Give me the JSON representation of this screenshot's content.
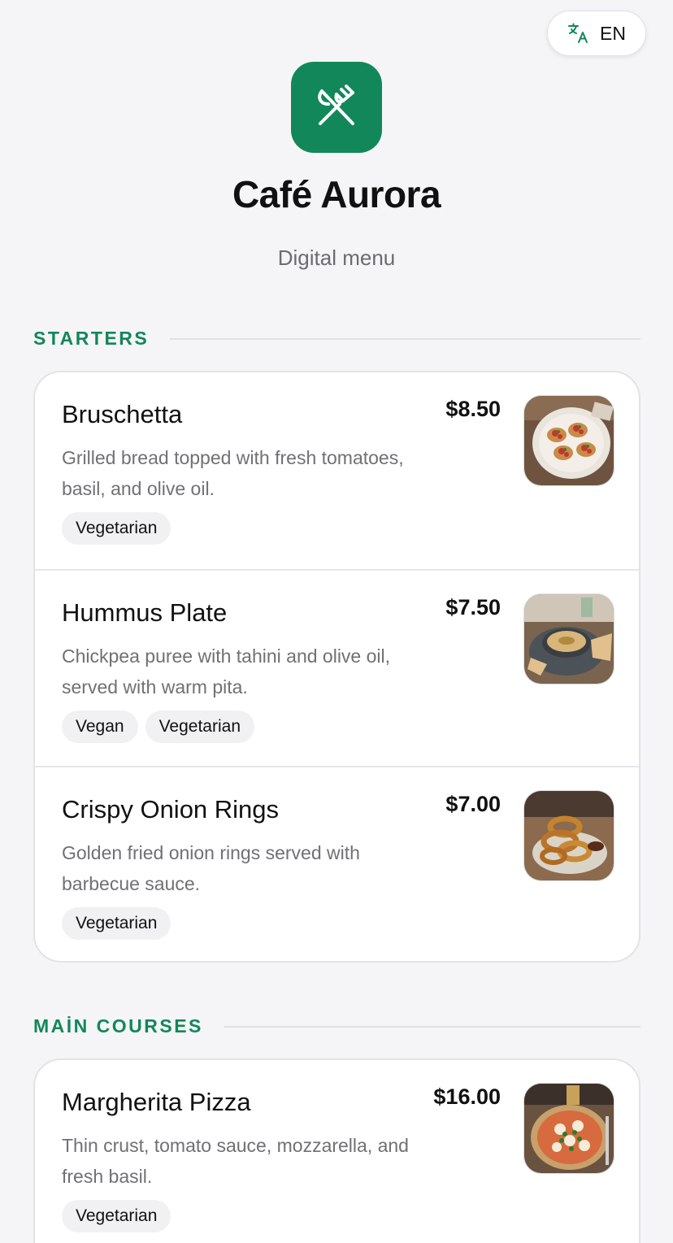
{
  "language": {
    "icon": "translate-icon",
    "code": "EN"
  },
  "brand": {
    "logo_icon": "utensils-crossed-icon",
    "accent": "#12875a",
    "name": "Café Aurora",
    "subtitle": "Digital menu"
  },
  "sections": [
    {
      "title": "STARTERS",
      "items": [
        {
          "name": "Bruschetta",
          "price": "$8.50",
          "description": "Grilled bread topped with fresh tomatoes, basil, and olive oil.",
          "tags": [
            "Vegetarian"
          ],
          "image": "bruschetta-photo"
        },
        {
          "name": "Hummus Plate",
          "price": "$7.50",
          "description": "Chickpea puree with tahini and olive oil, served with warm pita.",
          "tags": [
            "Vegan",
            "Vegetarian"
          ],
          "image": "hummus-photo"
        },
        {
          "name": "Crispy Onion Rings",
          "price": "$7.00",
          "description": "Golden fried onion rings served with barbecue sauce.",
          "tags": [
            "Vegetarian"
          ],
          "image": "onion-rings-photo"
        }
      ]
    },
    {
      "title": "MAİN COURSES",
      "items": [
        {
          "name": "Margherita Pizza",
          "price": "$16.00",
          "description": "Thin crust, tomato sauce, mozzarella, and fresh basil.",
          "tags": [
            "Vegetarian"
          ],
          "image": "pizza-photo"
        }
      ]
    }
  ]
}
